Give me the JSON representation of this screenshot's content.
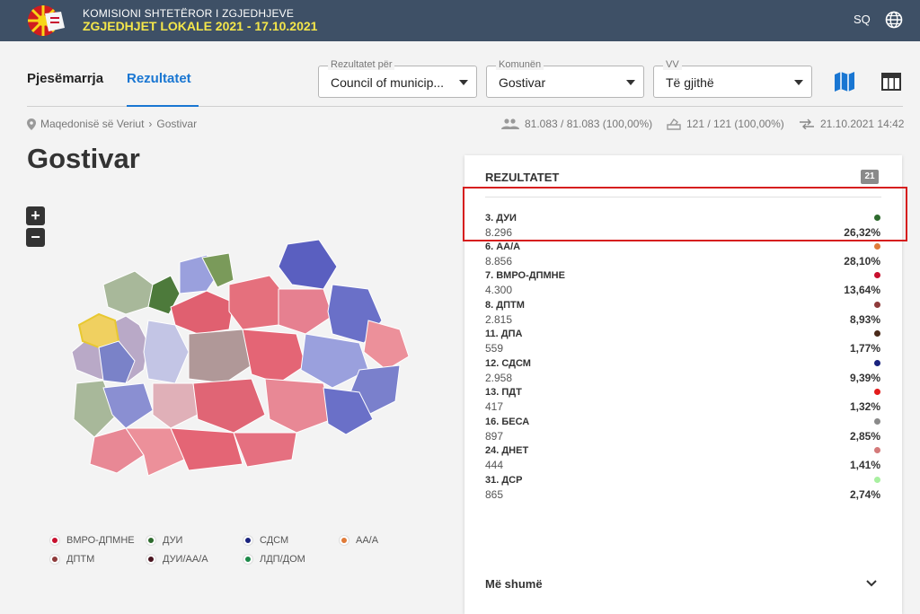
{
  "header": {
    "org": "KOMISIONI SHTETËROR I ZGJEDHJEVE",
    "election": "ZGJEDHJET LOKALE 2021 - 17.10.2021",
    "lang": "SQ",
    "logo_icon": "sun-flag-logo",
    "globe_icon": "globe-icon"
  },
  "tabs": [
    {
      "label": "Pjesëmarrja",
      "active": false
    },
    {
      "label": "Rezultatet",
      "active": true
    }
  ],
  "filters": [
    {
      "label": "Rezultatet për",
      "value": "Council of municip..."
    },
    {
      "label": "Komunën",
      "value": "Gostivar"
    },
    {
      "label": "VV",
      "value": "Të gjithë"
    }
  ],
  "breadcrumb": {
    "root": "Maqedonisë së Veriut",
    "current": "Gostivar"
  },
  "stats": {
    "voters": "81.083 / 81.083 (100,00%)",
    "stations": "121 / 121 (100,00%)",
    "updated": "21.10.2021 14:42"
  },
  "page_title": "Gostivar",
  "zoom": {
    "in": "+",
    "out": "−"
  },
  "legend": [
    {
      "label": "ВМРО-ДПМНЕ",
      "color": "#c8102e"
    },
    {
      "label": "ДУИ",
      "color": "#2e6b2e"
    },
    {
      "label": "СДСМ",
      "color": "#1a237e"
    },
    {
      "label": "АА/А",
      "color": "#e07b39"
    },
    {
      "label": "ДПТМ",
      "color": "#8e3b3b"
    },
    {
      "label": "ДУИ/АА/А",
      "color": "#4a1520"
    },
    {
      "label": "ЛДП/ДОМ",
      "color": "#1e8a4a"
    }
  ],
  "results": {
    "title": "REZULTATET",
    "badge": "21",
    "rows": [
      {
        "name": "3. ДУИ",
        "votes": "8.296",
        "pct": "26,32%",
        "color": "#2e6b2e"
      },
      {
        "name": "6. АА/А",
        "votes": "8.856",
        "pct": "28,10%",
        "color": "#e07b39"
      },
      {
        "name": "7. ВМРО-ДПМНЕ",
        "votes": "4.300",
        "pct": "13,64%",
        "color": "#c8102e"
      },
      {
        "name": "8. ДПТМ",
        "votes": "2.815",
        "pct": "8,93%",
        "color": "#8e3b3b"
      },
      {
        "name": "11. ДПА",
        "votes": "559",
        "pct": "1,77%",
        "color": "#4a2a1a"
      },
      {
        "name": "12. СДСМ",
        "votes": "2.958",
        "pct": "9,39%",
        "color": "#1a237e"
      },
      {
        "name": "13. ПДТ",
        "votes": "417",
        "pct": "1,32%",
        "color": "#e31b1b"
      },
      {
        "name": "16. БЕСА",
        "votes": "897",
        "pct": "2,85%",
        "color": "#8a8a8a"
      },
      {
        "name": "24. ДНЕТ",
        "votes": "444",
        "pct": "1,41%",
        "color": "#d47a7a"
      },
      {
        "name": "31. ДСР",
        "votes": "865",
        "pct": "2,74%",
        "color": "#a8f0a0"
      }
    ],
    "more": "Më shumë"
  }
}
